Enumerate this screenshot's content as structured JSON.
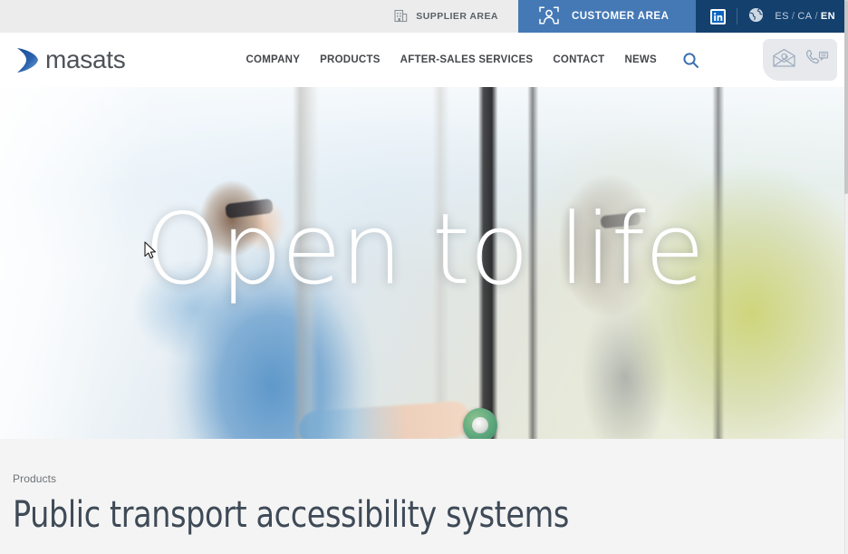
{
  "topbar": {
    "supplier_area": {
      "label": "SUPPLIER AREA",
      "icon": "supplier-building-icon"
    },
    "customer_area": {
      "label": "CUSTOMER AREA",
      "icon": "customer-person-scan-icon",
      "active": true,
      "bg_color": "#4579b5"
    },
    "social": {
      "linkedin_label": "in",
      "icon": "linkedin-icon"
    },
    "language": {
      "globe_icon": "globe-icon",
      "options": [
        "ES",
        "CA",
        "EN"
      ],
      "separator": "/",
      "selected": "EN"
    },
    "bg_color": "#ececec",
    "navy_color": "#14406e"
  },
  "header": {
    "logo": {
      "text": "masats",
      "mark_icon": "masats-wing-logo-icon",
      "mark_color": "#1f4e96",
      "text_color": "#4d5258"
    },
    "nav": [
      {
        "label": "COMPANY"
      },
      {
        "label": "PRODUCTS"
      },
      {
        "label": "AFTER-SALES SERVICES"
      },
      {
        "label": "CONTACT"
      },
      {
        "label": "NEWS"
      }
    ],
    "search": {
      "icon": "search-icon",
      "color": "#3a6fb0"
    },
    "contact_box": {
      "email_icon": "email-envelope-icon",
      "phone_icon": "phone-chat-icon",
      "bg_color": "#e7e9ec"
    }
  },
  "hero": {
    "title": "Open to life",
    "alt": "Woman in blue jacket pressing a green accessibility button on a bus door",
    "title_color": "#ffffff"
  },
  "intro": {
    "breadcrumb": "Products",
    "title": "Public transport accessibility systems",
    "bg_color": "#f4f4f4",
    "title_color": "#3f4a57"
  }
}
